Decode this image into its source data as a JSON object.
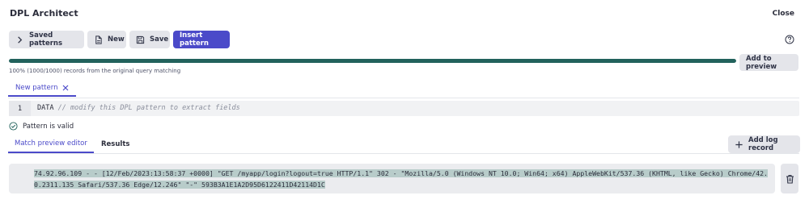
{
  "header": {
    "title": "DPL Architect",
    "close_label": "Close"
  },
  "toolbar": {
    "saved_patterns_label": "Saved patterns",
    "new_label": "New",
    "save_label": "Save",
    "insert_label": "Insert pattern"
  },
  "preview": {
    "progress_percent": 100,
    "add_to_preview_label": "Add to preview",
    "summary": "100% (1000/1000) records from the original query matching"
  },
  "pattern_tab": {
    "label": "New pattern"
  },
  "editor": {
    "line_number": "1",
    "code_keyword": "DATA",
    "code_comment": "// modify this DPL pattern to extract fields"
  },
  "status": {
    "valid_text": "Pattern is valid"
  },
  "tabs": {
    "match_preview": "Match preview editor",
    "results": "Results"
  },
  "log": {
    "add_label": "Add log record",
    "record": "74.92.96.109 - - [12/Feb/2023:13:58:37 +0000] \"GET /myapp/login?logout=true HTTP/1.1\" 302 - \"Mozilla/5.0 (Windows NT 10.0; Win64; x64) AppleWebKit/537.36 (KHTML, like Gecko) Chrome/42.0.2311.135 Safari/537.36 Edge/12.246\" \"-\" 593B3A1E1A2D95D6122411D42114D1C"
  },
  "colors": {
    "accent": "#4b4ac9",
    "progress": "#22625c",
    "highlight": "#b8ccca"
  }
}
